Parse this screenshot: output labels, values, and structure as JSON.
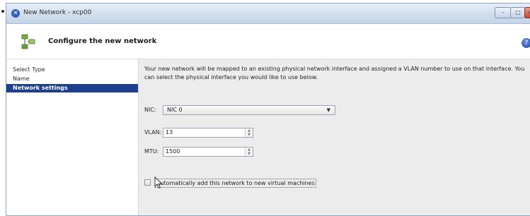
{
  "window": {
    "title": "New Network - xcp00",
    "controls": {
      "minimize": "–",
      "maximize": "□",
      "close": "×"
    }
  },
  "header": {
    "title": "Configure the new network",
    "icon": "network-wizard-icon",
    "help_icon": "help-icon"
  },
  "sidebar": {
    "items": [
      {
        "label": "Select Type",
        "active": false
      },
      {
        "label": "Name",
        "active": false
      },
      {
        "label": "Network settings",
        "active": true
      }
    ]
  },
  "main": {
    "description": "Your new network will be mapped to an existing physical network interface and assigned a VLAN number to use on that interface. You can select the physical interface you would like to use below.",
    "nic": {
      "label": "NIC:",
      "value": "NIC 0"
    },
    "vlan": {
      "label": "VLAN:",
      "value": "13"
    },
    "mtu": {
      "label": "MTU:",
      "value": "1500"
    },
    "auto_add": {
      "label": "Automatically add this network to new virtual machines",
      "checked": false
    }
  },
  "colors": {
    "accent": "#1e3f8e",
    "titlebar": "#d0dcec",
    "panel": "#ececec"
  }
}
